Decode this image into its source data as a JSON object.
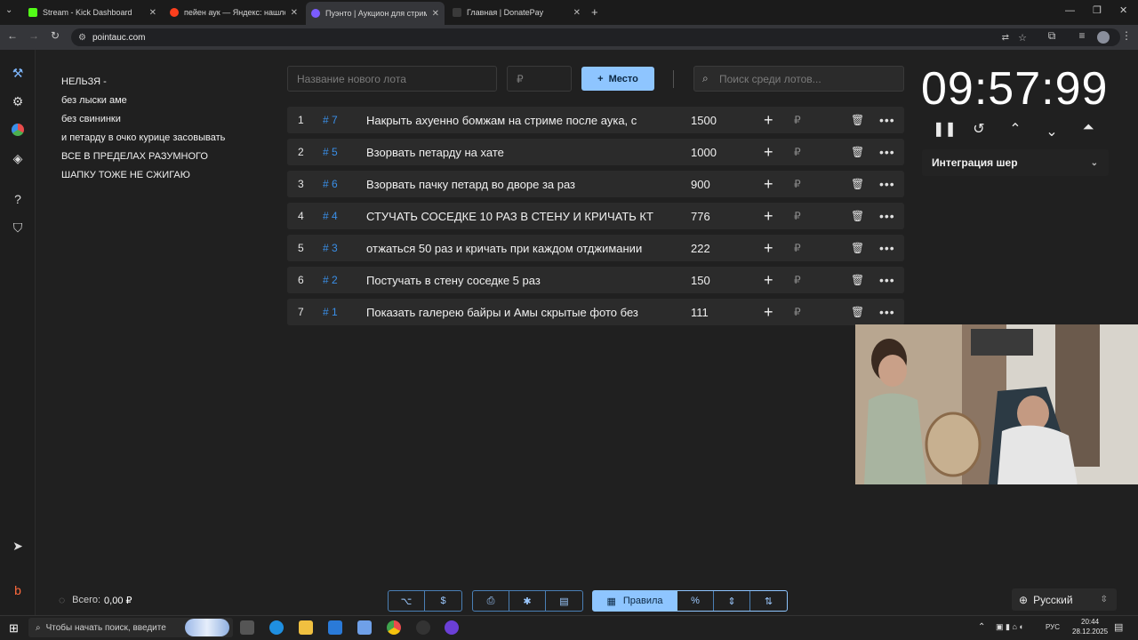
{
  "browser": {
    "tabs": [
      {
        "title": "Stream - Kick Dashboard",
        "color": "#53fc18"
      },
      {
        "title": "пейен аук — Яндекс: нашлось",
        "color": "#fc3f1d"
      },
      {
        "title": "Пуэнто | Аукцион для стримеров",
        "color": "#7b5cff"
      },
      {
        "title": "Главная | DonatePay",
        "color": "#2b2b2b"
      }
    ],
    "url": "pointauc.com"
  },
  "rules": [
    "НЕЛЬЗЯ -",
    "без лыски аме",
    "без свининки",
    "и петарду в очко курице засовывать",
    "ВСЕ В ПРЕДЕЛАХ РАЗУМНОГО",
    "ШАПКУ ТОЖЕ НЕ СЖИГАЮ"
  ],
  "form": {
    "lot_placeholder": "Название нового лота",
    "currency_placeholder": "₽",
    "place_label": "Место",
    "search_placeholder": "Поиск среди лотов..."
  },
  "lots": [
    {
      "num": "1",
      "id": "# 7",
      "title": "Накрыть ахуенно бомжам на стриме после аука, с",
      "amount": "1500"
    },
    {
      "num": "2",
      "id": "# 5",
      "title": "Взорвать петарду на хате",
      "amount": "1000"
    },
    {
      "num": "3",
      "id": "# 6",
      "title": "Взорвать пачку петард во дворе за раз",
      "amount": "900"
    },
    {
      "num": "4",
      "id": "# 4",
      "title": "СТУЧАТЬ СОСЕДКЕ 10 РАЗ В СТЕНУ И КРИЧАТЬ КТ",
      "amount": "776"
    },
    {
      "num": "5",
      "id": "# 3",
      "title": "отжаться 50 раз и кричать при каждом отджимании",
      "amount": "222"
    },
    {
      "num": "6",
      "id": "# 2",
      "title": "Постучать в стену соседке 5 раз",
      "amount": "150"
    },
    {
      "num": "7",
      "id": "# 1",
      "title": "Показать галерею байры и Амы скрытые фото без",
      "amount": "111"
    }
  ],
  "row_currency": "₽",
  "timer": "09:57:99",
  "integration_label": "Интеграция шер",
  "total_label": "Всего:",
  "total_value": "0,00 ₽",
  "rules_button": "Правила",
  "language": "Русский",
  "taskbar": {
    "search_placeholder": "Чтобы начать поиск, введите",
    "time": "20:44",
    "date": "28.12.2025",
    "lang": "РУС"
  }
}
